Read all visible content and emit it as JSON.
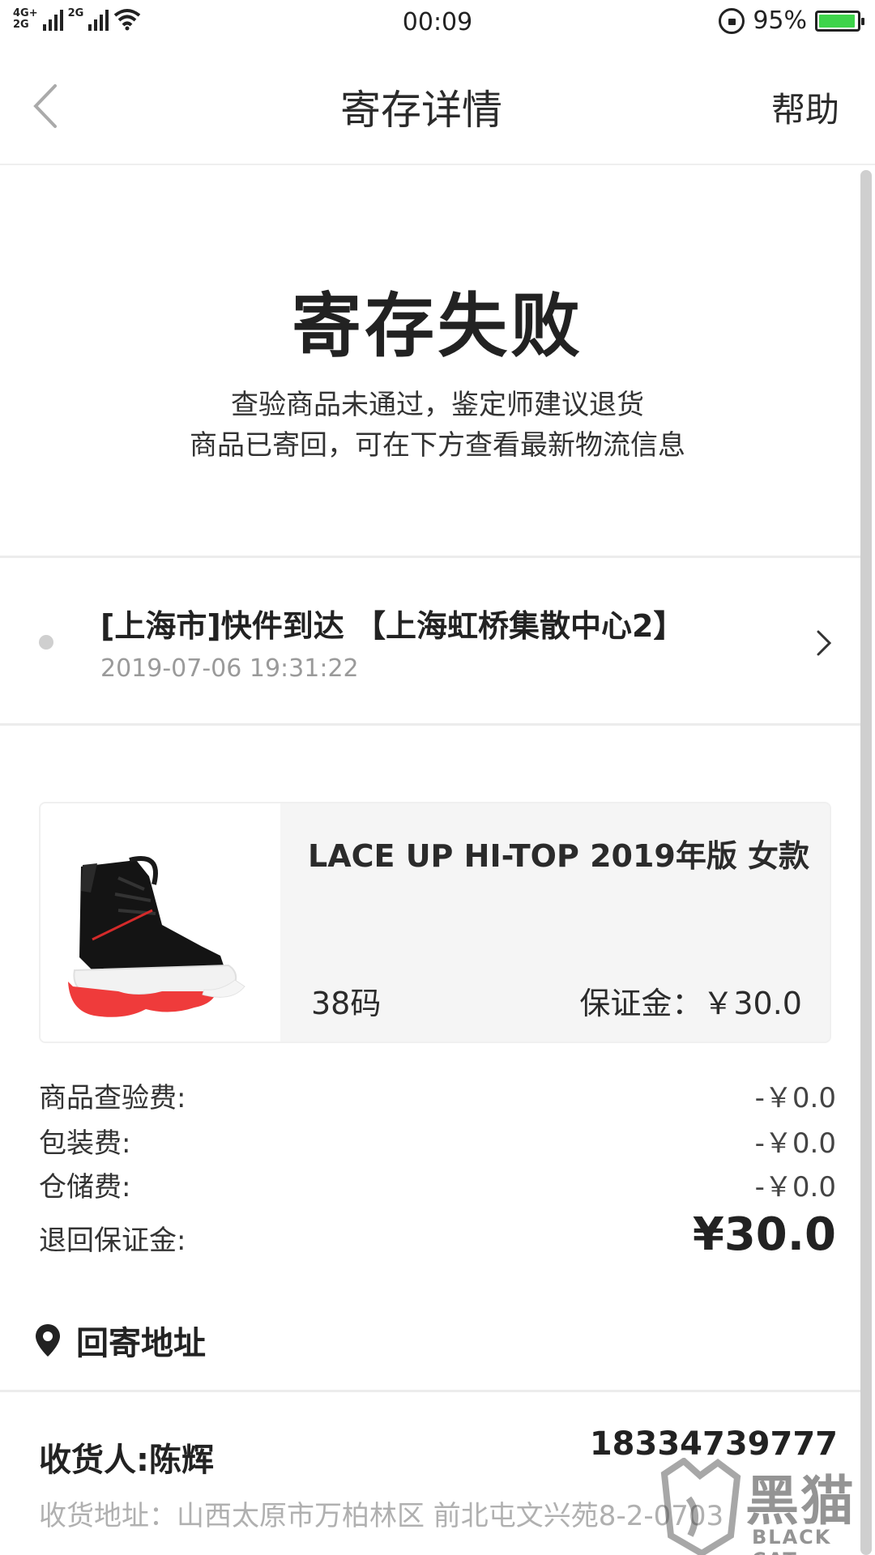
{
  "status_bar": {
    "network_top": "4G+",
    "network_bottom": "2G",
    "network_second": "2G",
    "time": "00:09",
    "battery_percent": "95%",
    "battery_level": 0.95,
    "wifi_icon": "wifi-icon",
    "lock_icon": "rotation-lock-icon"
  },
  "nav": {
    "title": "寄存详情",
    "help": "帮助",
    "back_icon": "chevron-left-icon"
  },
  "status": {
    "title": "寄存失败",
    "line1": "查验商品未通过，鉴定师建议退货",
    "line2": "商品已寄回，可在下方查看最新物流信息"
  },
  "logistics": {
    "title": "[上海市]快件到达 【上海虹桥集散中心2】",
    "time": "2019-07-06 19:31:22"
  },
  "product": {
    "name": "LACE UP HI-TOP 2019年版 女款",
    "size": "38码",
    "deposit": "保证金：￥30.0",
    "image": "sneaker-image"
  },
  "fees": [
    {
      "label": "商品查验费:",
      "value": "-￥0.0"
    },
    {
      "label": "包装费:",
      "value": "-￥0.0"
    },
    {
      "label": "仓储费:",
      "value": "-￥0.0"
    }
  ],
  "refund": {
    "label": "退回保证金:",
    "value": "¥30.0"
  },
  "address": {
    "section_title": "回寄地址",
    "receiver": "收货人:陈辉",
    "phone": "18334739777",
    "address": "收货地址：山西太原市万柏林区 前北屯文兴苑8-2-0703"
  },
  "watermark": {
    "text": "黑猫",
    "sub": "BLACK CAT"
  },
  "colors": {
    "text_primary": "#2b2b2b",
    "text_secondary": "#9a9a9a",
    "card_bg": "#f5f5f5",
    "battery_green": "#3ed44a"
  }
}
